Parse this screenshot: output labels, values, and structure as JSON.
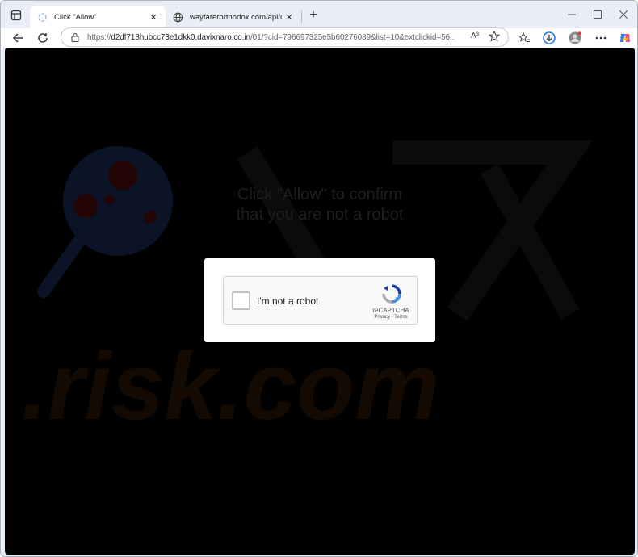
{
  "browser": {
    "tabs": [
      {
        "title": "Click \"Allow\"",
        "active": true
      },
      {
        "title": "wayfarerorthodox.com/api/users",
        "active": false
      }
    ],
    "address": {
      "prefix": "https://",
      "host": "d2df718hubcc73e1dkk0.davixnaro.co.in",
      "path": "/01/?cid=796697325e5b60276089&list=10&extclickid=56..."
    },
    "read_aloud_label": "A³"
  },
  "page": {
    "headline_line1": "Click \"Allow\" to confirm",
    "headline_line2": "that you are not a robot",
    "watermark_text": "risk.com",
    "captcha": {
      "checkbox_label": "I'm not a robot",
      "brand": "reCAPTCHA",
      "links": "Privacy - Terms"
    }
  },
  "colors": {
    "page_background": "#000000",
    "accent": "#1a73e8"
  }
}
